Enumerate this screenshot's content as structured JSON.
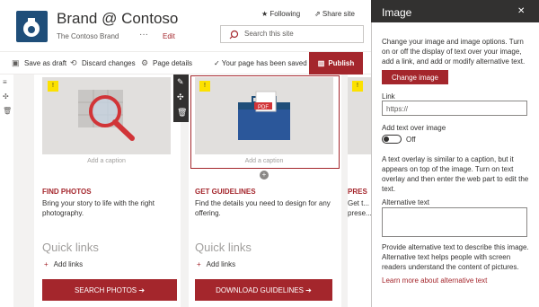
{
  "site": {
    "title": "Brand @ Contoso",
    "subtitle": "The Contoso Brand",
    "more": "···",
    "edit": "Edit",
    "following": "★ Following",
    "share": "⇗ Share site",
    "search_placeholder": "Search this site"
  },
  "commands": {
    "save_draft": "Save as draft",
    "discard": "Discard changes",
    "details": "Page details",
    "saved_status": "✓ Your page has been saved",
    "publish": "Publish"
  },
  "cards": [
    {
      "caption": "Add a caption",
      "title": "FIND PHOTOS",
      "desc": "Bring your story to life with the right photography.",
      "quick_links": "Quick links",
      "add_links": "Add links",
      "cta": "SEARCH PHOTOS ➔"
    },
    {
      "caption": "Add a caption",
      "title": "GET GUIDELINES",
      "desc": "Find the details you need to design for any offering.",
      "quick_links": "Quick links",
      "add_links": "Add links",
      "cta": "DOWNLOAD GUIDELINES ➔"
    },
    {
      "title": "PRES",
      "desc": "Get t... prese..."
    }
  ],
  "pdf_label": "PDF",
  "panel": {
    "title": "Image",
    "intro": "Change your image and image options. Turn on or off the display of text over your image, add a link, and add or modify alternative text.",
    "change_image": "Change image",
    "link_label": "Link",
    "link_value": "https://",
    "overlay_label": "Add text over image",
    "overlay_state": "Off",
    "overlay_desc": "A text overlay is similar to a caption, but it appears on top of the image. Turn on text overlay and then enter the web part to edit the text.",
    "alt_label": "Alternative text",
    "alt_desc": "Provide alternative text to describe this image. Alternative text helps people with screen readers understand the content of pictures.",
    "learn_more": "Learn more about alternative text"
  }
}
